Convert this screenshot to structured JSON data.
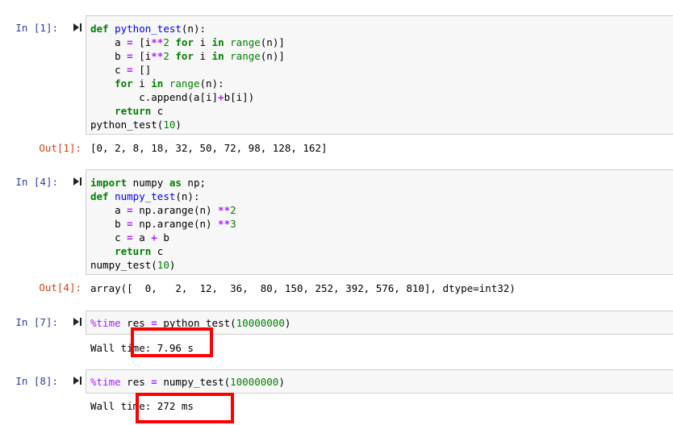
{
  "cells": [
    {
      "in_prompt": "In  [1]:",
      "out_prompt": "Out[1]:",
      "output": "[0, 2, 8, 18, 32, 50, 72, 98, 128, 162]",
      "code_tokens": {
        "l1": [
          "def",
          " ",
          "python_test",
          "(n):"
        ],
        "l2": [
          "    a ",
          "=",
          " [i",
          "**",
          "2",
          " ",
          "for",
          " i ",
          "in",
          " ",
          "range",
          "(n)]"
        ],
        "l3": [
          "    b ",
          "=",
          " [i",
          "**",
          "2",
          " ",
          "for",
          " i ",
          "in",
          " ",
          "range",
          "(n)]"
        ],
        "l4": [
          "    c ",
          "=",
          " []"
        ],
        "l5": [
          "    ",
          "for",
          " i ",
          "in",
          " ",
          "range",
          "(n):"
        ],
        "l6": [
          "        c.append(a[i]",
          "+",
          "b[i])"
        ],
        "l7": [
          "    ",
          "return",
          " c"
        ],
        "l8": [
          "python_test(",
          "10",
          ")"
        ]
      }
    },
    {
      "in_prompt": "In  [4]:",
      "out_prompt": "Out[4]:",
      "output": "array([  0,   2,  12,  36,  80, 150, 252, 392, 576, 810], dtype=int32)",
      "code_tokens": {
        "l1": [
          "import",
          " numpy ",
          "as",
          " np;"
        ],
        "l2": [
          "def",
          " ",
          "numpy_test",
          "(n):"
        ],
        "l3": [
          "    a ",
          "=",
          " np.arange(n) ",
          "**",
          "2"
        ],
        "l4": [
          "    b ",
          "=",
          " np.arange(n) ",
          "**",
          "3"
        ],
        "l5": [
          "    c ",
          "=",
          " a ",
          "+",
          " b"
        ],
        "l6": [
          "    ",
          "return",
          " c"
        ],
        "l7": [
          "numpy_test(",
          "10",
          ")"
        ]
      }
    },
    {
      "in_prompt": "In  [7]:",
      "output": "Wall time: 7.96 s",
      "code_tokens": {
        "l1": [
          "%time",
          " res ",
          "=",
          " python_test(",
          "10000000",
          ")"
        ]
      }
    },
    {
      "in_prompt": "In  [8]:",
      "output": "Wall time: 272 ms",
      "code_tokens": {
        "l1": [
          "%time",
          " res ",
          "=",
          " numpy_test(",
          "10000000",
          ")"
        ]
      }
    }
  ],
  "colors": {
    "in_prompt": "#303f9f",
    "out_prompt": "#d84315",
    "keyword": "#008000",
    "function_name": "#0000ff",
    "operator": "#aa22ff",
    "highlight_box": "#ff0000",
    "code_bg": "#f7f7f7"
  },
  "icons": {
    "run": "run-cell-icon"
  }
}
